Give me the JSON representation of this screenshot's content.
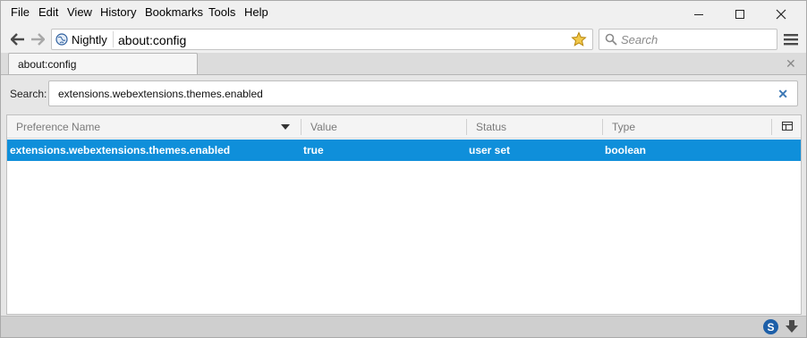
{
  "menubar": {
    "items": [
      {
        "label": "File",
        "key": "F"
      },
      {
        "label": "Edit",
        "key": "E"
      },
      {
        "label": "View",
        "key": "V"
      },
      {
        "label": "History",
        "key": "s"
      },
      {
        "label": "Bookmarks",
        "key": "B"
      },
      {
        "label": "Tools",
        "key": "T"
      },
      {
        "label": "Help",
        "key": "H"
      }
    ]
  },
  "navbar": {
    "identity_label": "Nightly",
    "url": "about:config",
    "search_placeholder": "Search"
  },
  "tabs": [
    {
      "label": "about:config",
      "active": true
    }
  ],
  "config": {
    "search_label": "Search:",
    "search_value": "extensions.webextensions.themes.enabled",
    "columns": [
      "Preference Name",
      "Value",
      "Status",
      "Type"
    ],
    "rows": [
      {
        "name": "extensions.webextensions.themes.enabled",
        "value": "true",
        "status": "user set",
        "type": "boolean",
        "selected": true
      }
    ]
  },
  "colors": {
    "selection": "#0f8fda",
    "accent": "#3c78b5"
  },
  "icons": [
    "back-icon",
    "forward-icon",
    "globe-icon",
    "star-icon",
    "search-icon",
    "hamburger-menu-icon",
    "close-icon",
    "column-picker-icon",
    "sort-descending-icon",
    "s-addon-icon",
    "download-icon"
  ]
}
